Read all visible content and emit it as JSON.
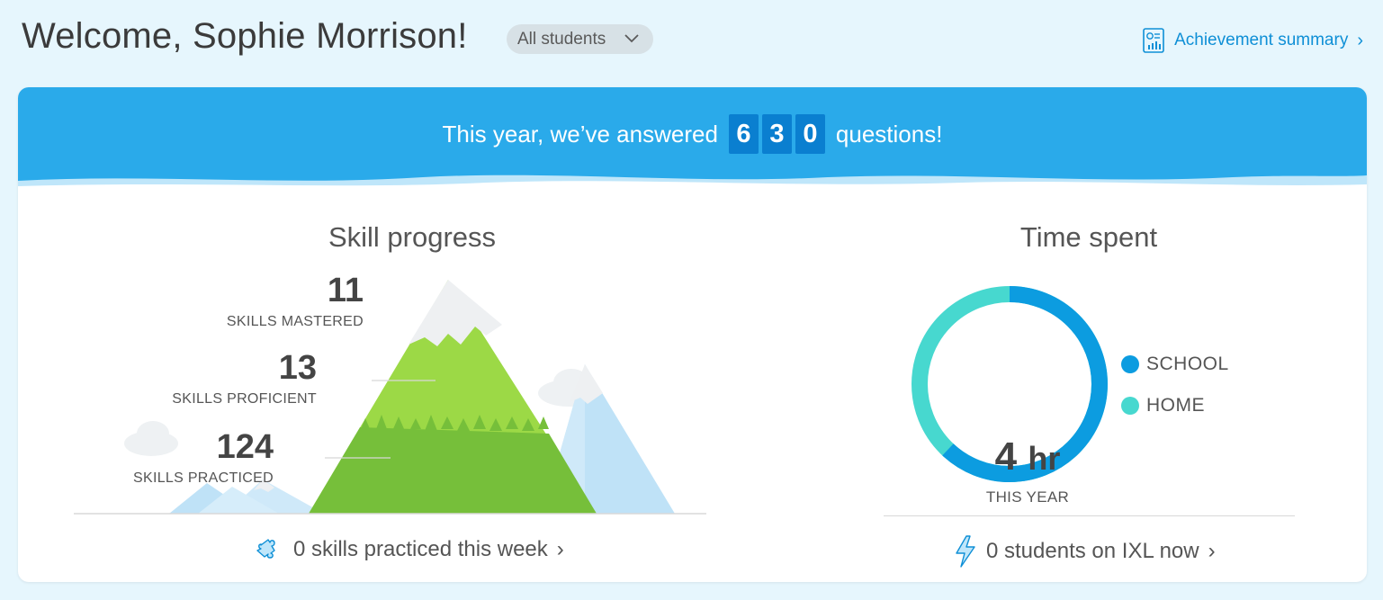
{
  "header": {
    "welcome": "Welcome, Sophie Morrison!",
    "student_filter": "All students",
    "achievement_link": "Achievement summary"
  },
  "banner": {
    "prefix": "This year, we’ve answered",
    "digits": [
      "6",
      "3",
      "0"
    ],
    "suffix": "questions!"
  },
  "skill_progress": {
    "title": "Skill progress",
    "mastered": {
      "value": "11",
      "label": "SKILLS MASTERED"
    },
    "proficient": {
      "value": "13",
      "label": "SKILLS PROFICIENT"
    },
    "practiced": {
      "value": "124",
      "label": "SKILLS PRACTICED"
    },
    "week_link": "0 skills practiced this week"
  },
  "time_spent": {
    "title": "Time spent",
    "value": "4",
    "unit": "hr",
    "period": "THIS YEAR",
    "school_fraction": 0.62,
    "legend": [
      {
        "label": "SCHOOL",
        "color": "#0c9ce0"
      },
      {
        "label": "HOME",
        "color": "#47d8cf"
      }
    ],
    "online_link": "0 students on IXL now"
  },
  "colors": {
    "accent": "#0e8fd6",
    "banner": "#2aaaea",
    "school": "#0c9ce0",
    "home": "#47d8cf"
  }
}
